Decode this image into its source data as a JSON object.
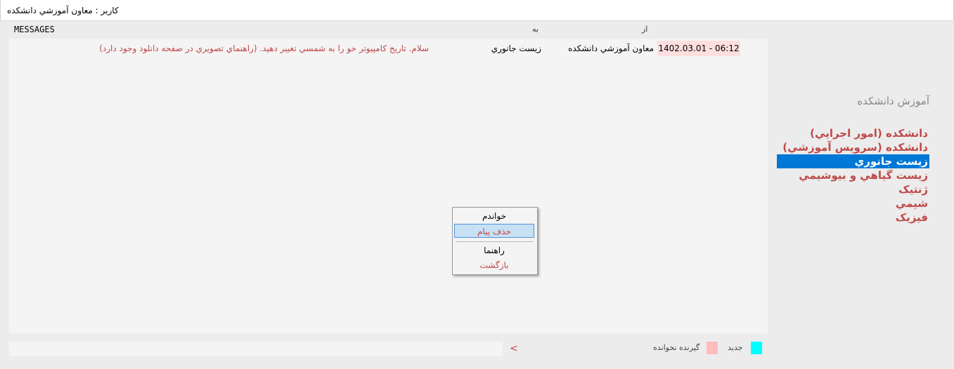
{
  "window": {
    "title": "کاربر : معاون آموزشي دانشکده"
  },
  "header": {
    "messages_label": "MESSAGES",
    "to_label": "به",
    "from_label": "از"
  },
  "messages": [
    {
      "date": "1402.03.01 - 06:12",
      "from": "معاون آموزشي دانشکده",
      "to": "زيست جانوري",
      "text": "سلام. تاريخ کامپيوتر خو را به شمسي تغيير دهيد. (راهنماي تصويري در صفحه دانلود وجود دارد)"
    }
  ],
  "sidebar": {
    "heading": "آموزش دانشکده",
    "items": [
      {
        "label": "دانشکده (امور اجرايي)",
        "selected": false
      },
      {
        "label": "دانشکده (سرويس آموزشي)",
        "selected": false
      },
      {
        "label": "زيست جانوري",
        "selected": true
      },
      {
        "label": "زيست گياهي و بيوشيمي",
        "selected": false
      },
      {
        "label": "ژنتيک",
        "selected": false
      },
      {
        "label": "شيمي",
        "selected": false
      },
      {
        "label": "فيزيک",
        "selected": false
      }
    ]
  },
  "context_menu": {
    "items": [
      {
        "label": "خواندم"
      },
      {
        "label": "حذف پيام"
      },
      {
        "label": "راهنما"
      },
      {
        "label": "بازگشت"
      }
    ]
  },
  "compose": {
    "value": "",
    "send_symbol": "<"
  },
  "legend": {
    "new_label": "جديد",
    "new_color": "#00ffff",
    "unread_label": "گيرنده نخوانده",
    "unread_color": "#ffbcbc"
  },
  "colors": {
    "accent": "#0078d7",
    "alert_text": "#c04848",
    "date_highlight": "#ffdede"
  }
}
